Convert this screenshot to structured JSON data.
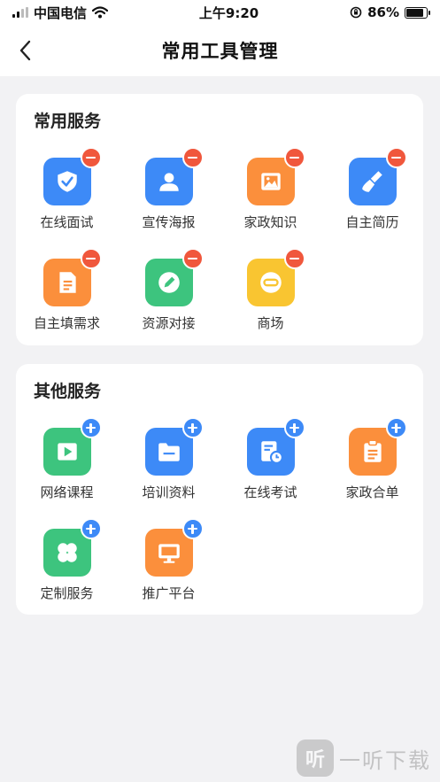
{
  "status_bar": {
    "carrier": "中国电信",
    "time": "上午9:20",
    "battery": "86%",
    "battery_level": 0.86
  },
  "nav": {
    "title": "常用工具管理",
    "back_icon": "chevron-left-icon"
  },
  "common_services": {
    "title": "常用服务",
    "action": "remove",
    "items": [
      {
        "label": "在线面试",
        "color": "#3d8af7",
        "icon": "shield-check-icon"
      },
      {
        "label": "宣传海报",
        "color": "#3d8af7",
        "icon": "person-card-icon"
      },
      {
        "label": "家政知识",
        "color": "#fb8f3c",
        "icon": "picture-icon"
      },
      {
        "label": "自主简历",
        "color": "#3d8af7",
        "icon": "broom-icon"
      },
      {
        "label": "自主填需求",
        "color": "#fb8f3c",
        "icon": "document-icon"
      },
      {
        "label": "资源对接",
        "color": "#3dc47e",
        "icon": "pencil-icon"
      },
      {
        "label": "商场",
        "color": "#f9c531",
        "icon": "link-icon"
      }
    ]
  },
  "other_services": {
    "title": "其他服务",
    "action": "add",
    "items": [
      {
        "label": "网络课程",
        "color": "#3dc47e",
        "icon": "play-video-icon"
      },
      {
        "label": "培训资料",
        "color": "#3d8af7",
        "icon": "folder-icon"
      },
      {
        "label": "在线考试",
        "color": "#3d8af7",
        "icon": "exam-clock-icon"
      },
      {
        "label": "家政合单",
        "color": "#fb8f3c",
        "icon": "clipboard-icon"
      },
      {
        "label": "定制服务",
        "color": "#3dc47e",
        "icon": "clover-icon"
      },
      {
        "label": "推广平台",
        "color": "#fb8f3c",
        "icon": "monitor-icon"
      }
    ]
  },
  "watermark": {
    "glyph": "听",
    "text": "一听下载"
  }
}
